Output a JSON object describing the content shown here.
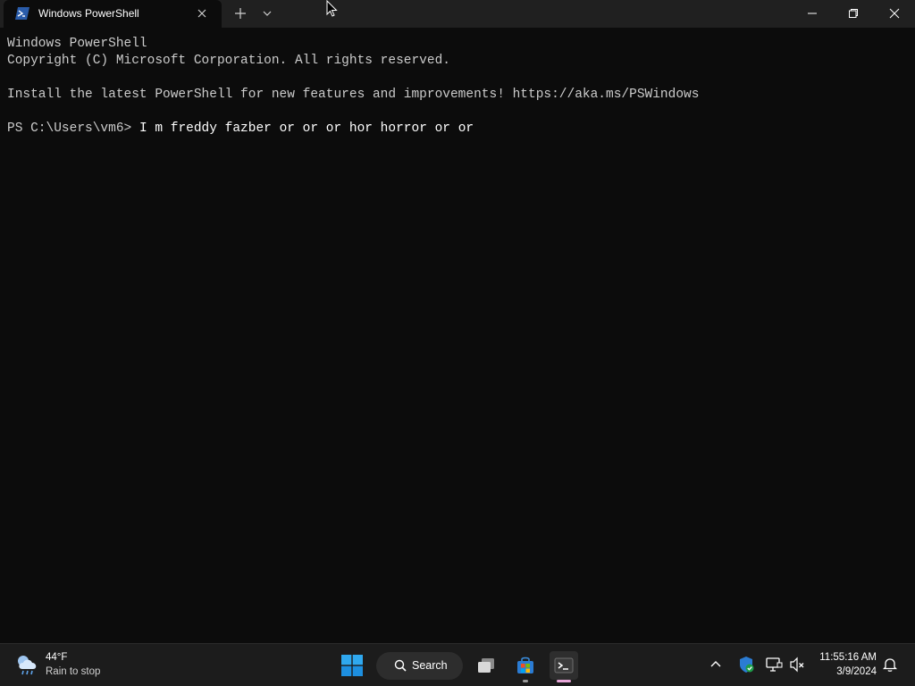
{
  "window": {
    "tab_title": "Windows PowerShell"
  },
  "terminal": {
    "line1": "Windows PowerShell",
    "line2": "Copyright (C) Microsoft Corporation. All rights reserved.",
    "line3": "",
    "line4": "Install the latest PowerShell for new features and improvements! https://aka.ms/PSWindows",
    "line5": "",
    "prompt": "PS C:\\Users\\vm6> ",
    "command": "I m freddy fazber or or or hor horror or or"
  },
  "taskbar": {
    "weather_temp": "44°F",
    "weather_desc": "Rain to stop",
    "search_label": "Search",
    "clock_time": "11:55:16 AM",
    "clock_date": "3/9/2024"
  },
  "icons": {
    "tab": "powershell-icon",
    "close": "close-icon",
    "new_tab": "plus-icon",
    "dropdown": "chevron-down-icon",
    "weather": "rain-cloud-icon",
    "start": "windows-logo-icon",
    "search": "search-icon",
    "task_view": "task-view-icon",
    "store": "store-icon",
    "terminal": "terminal-icon",
    "tray_chevron": "chevron-up-icon",
    "defender": "shield-icon",
    "network": "network-icon",
    "volume": "volume-muted-icon",
    "notification": "bell-icon"
  },
  "colors": {
    "terminal_bg": "#0c0c0c",
    "terminal_text": "#cccccc",
    "titlebar_bg": "#202020",
    "taskbar_bg": "#1c1c1c",
    "accent_terminal_indicator": "#e7a6d8",
    "powershell_blue": "#2a5caa"
  }
}
